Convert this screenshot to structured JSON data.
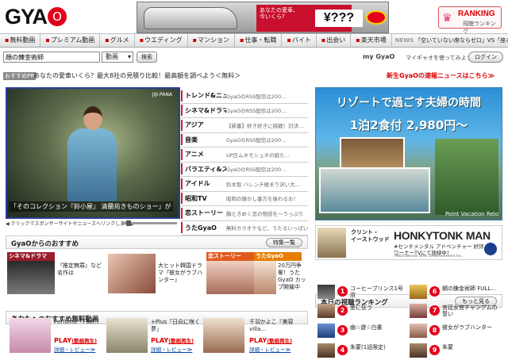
{
  "logo": {
    "text": "GYA",
    "o": "O"
  },
  "top_ad": {
    "question": "あなたの愛車、\n今いくら?",
    "price": "¥???",
    "small": "gulliver"
  },
  "ranking_button": {
    "icon": "crown-icon",
    "title": "RANKING",
    "sub": "視聴ランキング"
  },
  "nav": {
    "items": [
      "無料動画",
      "プレミアム動画",
      "グルメ",
      "ウエディング",
      "マンション",
      "仕事・転職",
      "バイト",
      "出会い",
      "楽天市場"
    ],
    "news_label": "NEWS",
    "news_text": "「空いていない席ならゼロ」VS「座るなら代金を払"
  },
  "search": {
    "value": "顔の錬金術師",
    "select": "動画",
    "button": "検索"
  },
  "mygyao": {
    "label": "my GyaO",
    "message": "マイギャオを使ってみよう",
    "login": "ログイン"
  },
  "pr": {
    "label": "おすすめPR",
    "text": "あなたの愛車いくら？最大8社の見積り比較！最高額を調べよう＜無料＞",
    "news_link": "新生GyaOの速報ニュースはこちら≫"
  },
  "player": {
    "watermark": "JIJI-PANA",
    "caption": "「そのコレクション『鈴小屋』 清蘭苑きものショー」が",
    "control_text": "◀ クリックでスポンサーサイトやニュースへリンクします ▶"
  },
  "categories": [
    {
      "name": "トレンド&ニュース",
      "desc": "GyaOのRSS配信は200…"
    },
    {
      "name": "シネマ&ドラマ",
      "desc": "GyaOのRSS配信は200…"
    },
    {
      "name": "アジア",
      "desc": "【新番】好き好きに挑戦！対決…"
    },
    {
      "name": "音楽",
      "desc": "GyaOのRSS配信は200…"
    },
    {
      "name": "アニメ",
      "desc": "UP圧ムネモシュネの娘た…"
    },
    {
      "name": "バラエティ&スポーツ",
      "desc": "GyaOのRSS配信は200…"
    },
    {
      "name": "アイドル",
      "desc": "鈴木智 ハレンチ極まり沢い大…"
    },
    {
      "name": "昭和TV",
      "desc": "昭和の懐かし番方を後わるお！"
    },
    {
      "name": "恋ストーリー",
      "desc": "胸ときめく恋の物語を〜うっぷり"
    },
    {
      "name": "うたGyaO",
      "desc": "無料カラオケなど、うたるいっぱい"
    }
  ],
  "resort_ad": {
    "line1": "リゾートで過ごす夫婦の時間",
    "line2": "1泊2食付 2,980円〜",
    "footer": "Point Vacation Relo"
  },
  "movie_ad": {
    "line1": "クリント・",
    "line2": "イーストウッド",
    "title": "HONKYTONK MAN",
    "sub1": "#センチメンタル アドベンチャー 好評",
    "sub2": "ワーナーTVにて放映中！",
    "copy": "TM&©Warner Bros. Entertainment Inc."
  },
  "recommend": {
    "title": "GyaOからのおすすめ",
    "button": "特集一覧",
    "cards": [
      {
        "header": "シネマ&ドラマ",
        "text": "『推定無罪』など名作は"
      },
      {
        "header": "",
        "text": "大ヒット韓国ドラマ『彼女がラブハンター』"
      },
      {
        "header": "恋ストーリー",
        "text": ""
      },
      {
        "header": "うたGyaO",
        "text": "20万円争奪！うたGyaO カップ開催中"
      }
    ]
  },
  "free": {
    "title": "あなたへのおすすめ無料動画",
    "items": [
      {
        "title": "Perfume「I stil…",
        "play": "PLAY",
        "play_sub": "(動画再生)",
        "detail": "詳細・レビュー≫"
      },
      {
        "title": "+Plus「日向に咲く夢」",
        "play": "PLAY",
        "play_sub": "(動画再生)",
        "detail": "詳細・レビュー≫"
      },
      {
        "title": "千羽かよこ『美容villa…",
        "play": "PLAY",
        "play_sub": "(動画再生)",
        "detail": "詳細・レビュー≫"
      }
    ]
  },
  "ranking": {
    "title": "本日の視聴ランキング",
    "button": "もっと見る",
    "items": [
      {
        "num": "1",
        "title": "コーヒープリンス1号店"
      },
      {
        "num": "2",
        "title": "愛に狂う"
      },
      {
        "num": "3",
        "title": "幽☆遊☆白書"
      },
      {
        "num": "4",
        "title": "朱蒙(1話限定)"
      },
      {
        "num": "6",
        "title": "鋼の錬金術師 FULL…"
      },
      {
        "num": "7",
        "title": "宮廷女官チャングムの誓い"
      },
      {
        "num": "8",
        "title": "彼女がラブハンター"
      },
      {
        "num": "9",
        "title": "朱蒙"
      }
    ]
  },
  "colors": {
    "brand_red": "#e3001b",
    "link_red": "#dd0000",
    "player_border": "#2a3f9a"
  }
}
